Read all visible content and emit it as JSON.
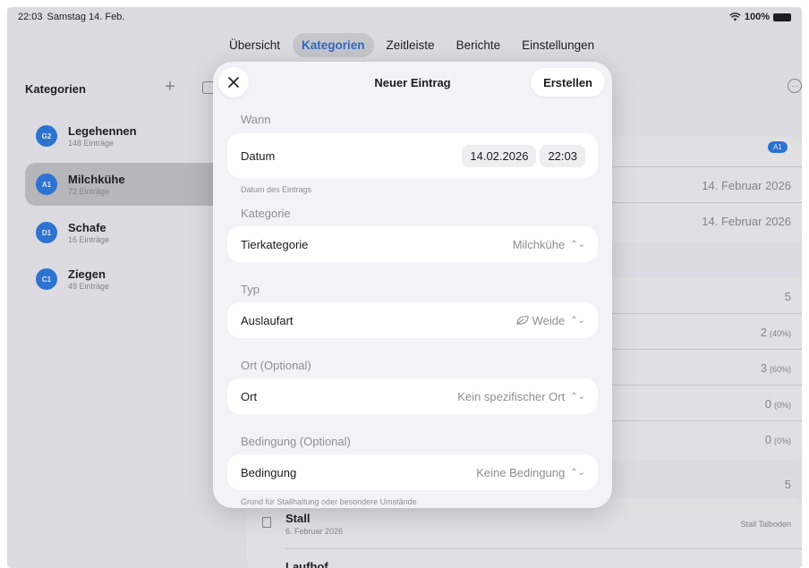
{
  "status": {
    "time": "22:03",
    "date": "Samstag 14. Feb.",
    "battery": "100%"
  },
  "nav": {
    "tabs": [
      "Übersicht",
      "Kategorien",
      "Zeitleiste",
      "Berichte",
      "Einstellungen"
    ],
    "active": "Kategorien"
  },
  "sidebar": {
    "title": "Kategorien",
    "items": [
      {
        "badge": "G2",
        "name": "Legehennen",
        "count": "148 Einträge"
      },
      {
        "badge": "A1",
        "name": "Milchkühe",
        "count": "72 Einträge"
      },
      {
        "badge": "D1",
        "name": "Schafe",
        "count": "16 Einträge"
      },
      {
        "badge": "C1",
        "name": "Ziegen",
        "count": "49 Einträge"
      }
    ]
  },
  "background": {
    "badge": "A1",
    "date1": "14. Februar 2026",
    "date2": "14. Februar 2026",
    "total": "5",
    "r1": "2",
    "r1p": "(40%)",
    "r2": "3",
    "r2p": "(60%)",
    "r3": "0",
    "r3p": "(0%)",
    "r4": "0",
    "r4p": "(0%)",
    "total2": "5",
    "stall_title": "Stall",
    "stall_date": "6. Februar 2026",
    "stall_location": "Stall Talboden",
    "next_title": "Laufhof"
  },
  "modal": {
    "title": "Neuer Eintrag",
    "create": "Erstellen",
    "when_label": "Wann",
    "date_label": "Datum",
    "date_value": "14.02.2026",
    "time_value": "22:03",
    "date_note": "Datum des Eintrags",
    "category_label": "Kategorie",
    "animal_label": "Tierkategorie",
    "animal_value": "Milchkühe",
    "type_label": "Typ",
    "outlet_label": "Auslaufart",
    "outlet_value": "Weide",
    "place_section": "Ort (Optional)",
    "place_label": "Ort",
    "place_value": "Kein spezifischer Ort",
    "condition_section": "Bedingung (Optional)",
    "condition_label": "Bedingung",
    "condition_value": "Keine Bedingung",
    "condition_note": "Grund für Stallhaltung oder besondere Umstände"
  }
}
